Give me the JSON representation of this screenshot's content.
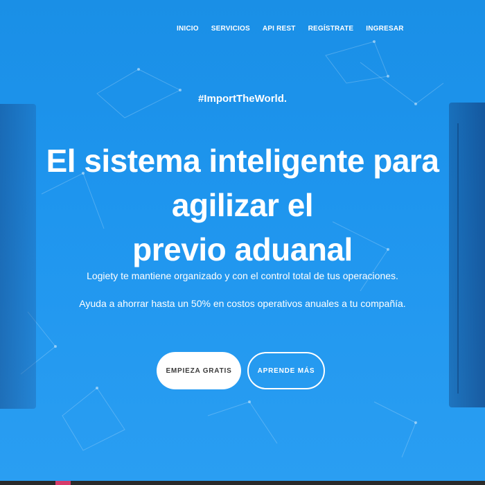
{
  "nav": {
    "items": [
      {
        "label": "INICIO"
      },
      {
        "label": "SERVICIOS"
      },
      {
        "label": "API REST"
      },
      {
        "label": "REGÍSTRATE"
      },
      {
        "label": "INGRESAR"
      }
    ]
  },
  "hero": {
    "hashtag": "#ImportTheWorld.",
    "headline_line1": "El sistema inteligente para agilizar el",
    "headline_line2": "previo aduanal",
    "subtext1": "Logiety te mantiene organizado y con el control total de tus operaciones.",
    "subtext2": "Ayuda a ahorrar hasta un 50% en costos operativos anuales a tu compañía.",
    "primary_button": "EMPIEZA GRATIS",
    "secondary_button": "APRENDE MÁS"
  },
  "colors": {
    "background": "#1e95ee",
    "text": "#ffffff",
    "primary_button_bg": "#ffffff",
    "primary_button_text": "#3a3a3a"
  }
}
